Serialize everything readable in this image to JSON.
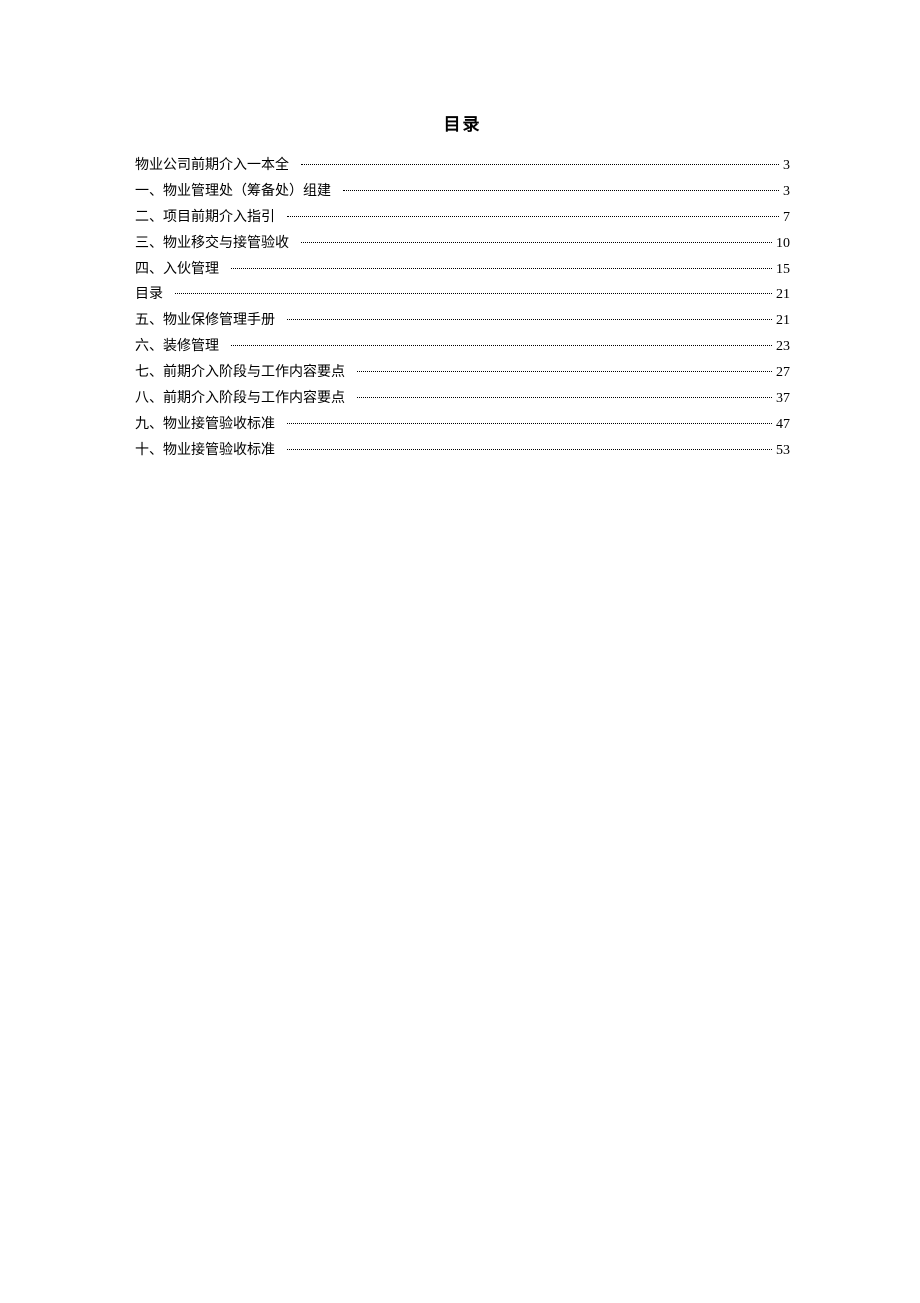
{
  "title": "目录",
  "entries": [
    {
      "label": "物业公司前期介入一本全",
      "page": "3"
    },
    {
      "label": "一、物业管理处（筹备处）组建",
      "page": "3"
    },
    {
      "label": "二、项目前期介入指引",
      "page": "7"
    },
    {
      "label": "三、物业移交与接管验收",
      "page": "10"
    },
    {
      "label": "四、入伙管理",
      "page": "15"
    },
    {
      "label": "目录",
      "page": "21"
    },
    {
      "label": "五、物业保修管理手册",
      "page": "21"
    },
    {
      "label": "六、装修管理",
      "page": "23"
    },
    {
      "label": "七、前期介入阶段与工作内容要点",
      "page": "27"
    },
    {
      "label": "八、前期介入阶段与工作内容要点",
      "page": "37"
    },
    {
      "label": "九、物业接管验收标准",
      "page": "47"
    },
    {
      "label": "十、物业接管验收标准",
      "page": "53"
    }
  ]
}
